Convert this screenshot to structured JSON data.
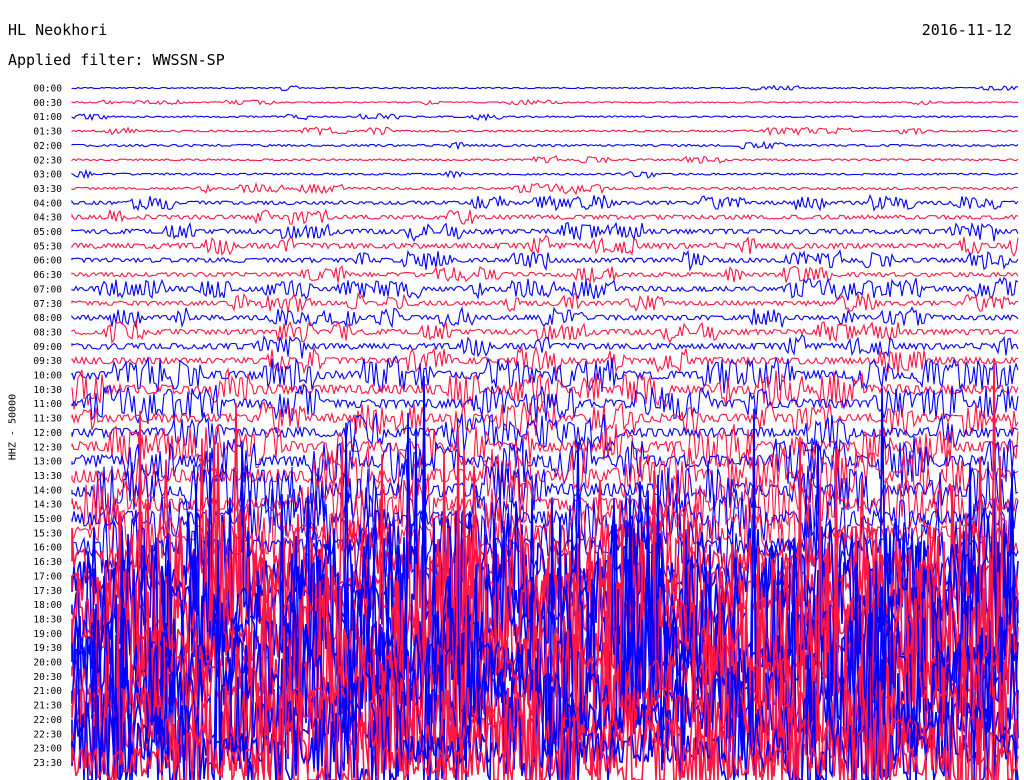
{
  "header": {
    "station": "HL Neokhori",
    "date": "2016-11-12",
    "filter": "Applied filter: WWSSN-SP"
  },
  "chart_data": {
    "type": "line",
    "title": "HL Neokhori",
    "date": "2016-11-12",
    "filter": "WWSSN-SP",
    "ylabel": "HHZ - 50000",
    "colors": [
      "#0000ff",
      "#ff1744"
    ],
    "line_labels": [
      "00:00",
      "00:30",
      "01:00",
      "01:30",
      "02:00",
      "02:30",
      "03:00",
      "03:30",
      "04:00",
      "04:30",
      "05:00",
      "05:30",
      "06:00",
      "06:30",
      "07:00",
      "07:30",
      "08:00",
      "08:30",
      "09:00",
      "09:30",
      "10:00",
      "10:30",
      "11:00",
      "11:30",
      "12:00",
      "12:30",
      "13:00",
      "13:30",
      "14:00",
      "14:30",
      "15:00",
      "15:30",
      "16:00",
      "16:30",
      "17:00",
      "17:30",
      "18:00",
      "18:30",
      "19:00",
      "19:30",
      "20:00",
      "20:30",
      "21:00",
      "21:30",
      "22:00",
      "22:30",
      "23:00",
      "23:30"
    ],
    "noise_level": [
      0.4,
      0.4,
      0.5,
      0.6,
      0.7,
      0.6,
      0.6,
      0.8,
      1.2,
      1.4,
      1.6,
      1.8,
      1.5,
      1.4,
      1.7,
      1.5,
      1.6,
      1.8,
      2.0,
      2.2,
      2.8,
      3.2,
      3.0,
      2.8,
      3.2,
      3.6,
      4.2,
      4.6,
      4.8,
      4.8,
      5.0,
      5.2,
      6,
      8,
      11,
      13,
      14,
      14,
      15,
      15,
      14,
      14,
      13,
      12,
      12,
      11,
      10,
      10
    ]
  }
}
